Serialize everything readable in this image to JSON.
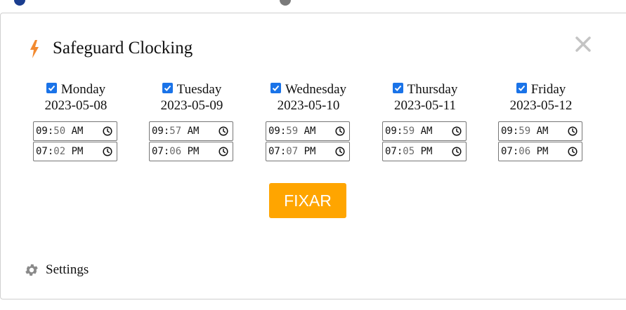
{
  "app": {
    "title": "Safeguard Clocking",
    "accent_color": "#ffa500",
    "bolt_color": "#f28a30",
    "checkbox_color": "#1a73e8"
  },
  "days": [
    {
      "label": "Monday",
      "date": "2023-05-08",
      "checked": true,
      "start": {
        "h": "09",
        "m": "50",
        "ap": "AM"
      },
      "end": {
        "h": "07",
        "m": "02",
        "ap": "PM"
      }
    },
    {
      "label": "Tuesday",
      "date": "2023-05-09",
      "checked": true,
      "start": {
        "h": "09",
        "m": "57",
        "ap": "AM"
      },
      "end": {
        "h": "07",
        "m": "06",
        "ap": "PM"
      }
    },
    {
      "label": "Wednesday",
      "date": "2023-05-10",
      "checked": true,
      "start": {
        "h": "09",
        "m": "59",
        "ap": "AM"
      },
      "end": {
        "h": "07",
        "m": "07",
        "ap": "PM"
      }
    },
    {
      "label": "Thursday",
      "date": "2023-05-11",
      "checked": true,
      "start": {
        "h": "09",
        "m": "59",
        "ap": "AM"
      },
      "end": {
        "h": "07",
        "m": "05",
        "ap": "PM"
      }
    },
    {
      "label": "Friday",
      "date": "2023-05-12",
      "checked": true,
      "start": {
        "h": "09",
        "m": "59",
        "ap": "AM"
      },
      "end": {
        "h": "07",
        "m": "06",
        "ap": "PM"
      }
    }
  ],
  "actions": {
    "fixar_label": "FIXAR",
    "settings_label": "Settings"
  },
  "icons": {
    "bolt": "lightning-bolt-icon",
    "close": "close-icon",
    "gear": "gear-icon",
    "clock": "clock-icon"
  }
}
